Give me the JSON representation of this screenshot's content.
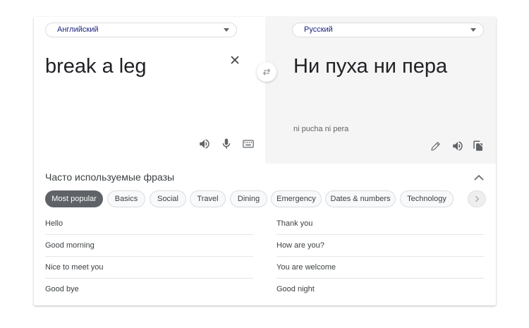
{
  "source": {
    "language": "Английский",
    "text": "break a leg"
  },
  "target": {
    "language": "Русский",
    "text": "Ни пуха ни пера",
    "transliteration": "ni pucha ni pera"
  },
  "icons": {
    "clear": "close-icon",
    "swap": "swap-icon",
    "source_listen": "speaker-icon",
    "mic": "microphone-icon",
    "keyboard": "keyboard-icon",
    "edit": "pencil-icon",
    "target_listen": "speaker-icon",
    "copy": "copy-icon",
    "collapse": "chevron-up-icon",
    "next": "chevron-right-icon"
  },
  "phrasebook": {
    "title": "Часто используемые фразы",
    "categories": [
      {
        "label": "Most popular",
        "active": true
      },
      {
        "label": "Basics",
        "active": false
      },
      {
        "label": "Social",
        "active": false
      },
      {
        "label": "Travel",
        "active": false
      },
      {
        "label": "Dining",
        "active": false
      },
      {
        "label": "Emergency",
        "active": false
      },
      {
        "label": "Dates & numbers",
        "active": false
      },
      {
        "label": "Technology",
        "active": false
      }
    ],
    "phrases_left": [
      "Hello",
      "Good morning",
      "Nice to meet you",
      "Good bye"
    ],
    "phrases_right": [
      "Thank you",
      "How are you?",
      "You are welcome",
      "Good night"
    ]
  },
  "colors": {
    "accent": "#1a237e",
    "active_chip": "#5f6368",
    "target_pane": "#f5f5f5"
  }
}
